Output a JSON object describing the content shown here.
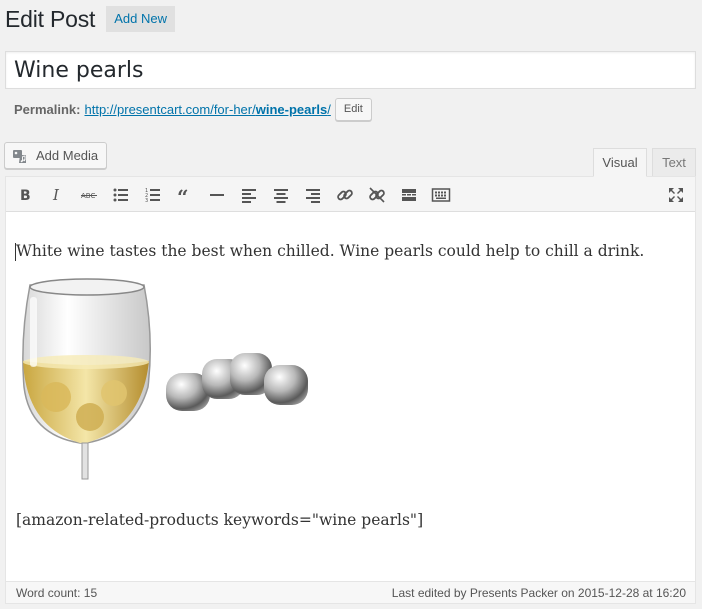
{
  "header": {
    "title": "Edit Post",
    "add_new_label": "Add New"
  },
  "post": {
    "title": "Wine pearls"
  },
  "permalink": {
    "label": "Permalink:",
    "url_base": "http://presentcart.com/for-her/",
    "slug": "wine-pearls",
    "url_end": "/",
    "edit_label": "Edit"
  },
  "media": {
    "add_media_label": "Add Media"
  },
  "editor_tabs": {
    "visual_label": "Visual",
    "text_label": "Text"
  },
  "toolbar": {
    "buttons": [
      "bold",
      "italic",
      "strikethrough",
      "bulleted-list",
      "numbered-list",
      "blockquote",
      "horizontal-line",
      "align-left",
      "align-center",
      "align-right",
      "insert-link",
      "remove-link",
      "read-more-tag",
      "toolbar-toggle",
      "fullscreen"
    ]
  },
  "content": {
    "paragraph": "White wine tastes the best when chilled. Wine pearls could help to chill a drink.",
    "shortcode": "[amazon-related-products keywords=\"wine pearls\"]"
  },
  "status": {
    "word_count": "Word count: 15",
    "last_edited": "Last edited by Presents Packer on 2015-12-28 at 16:20"
  },
  "colors": {
    "link": "#0073aa",
    "background": "#f1f1f1",
    "toolbar": "#f5f5f5"
  }
}
